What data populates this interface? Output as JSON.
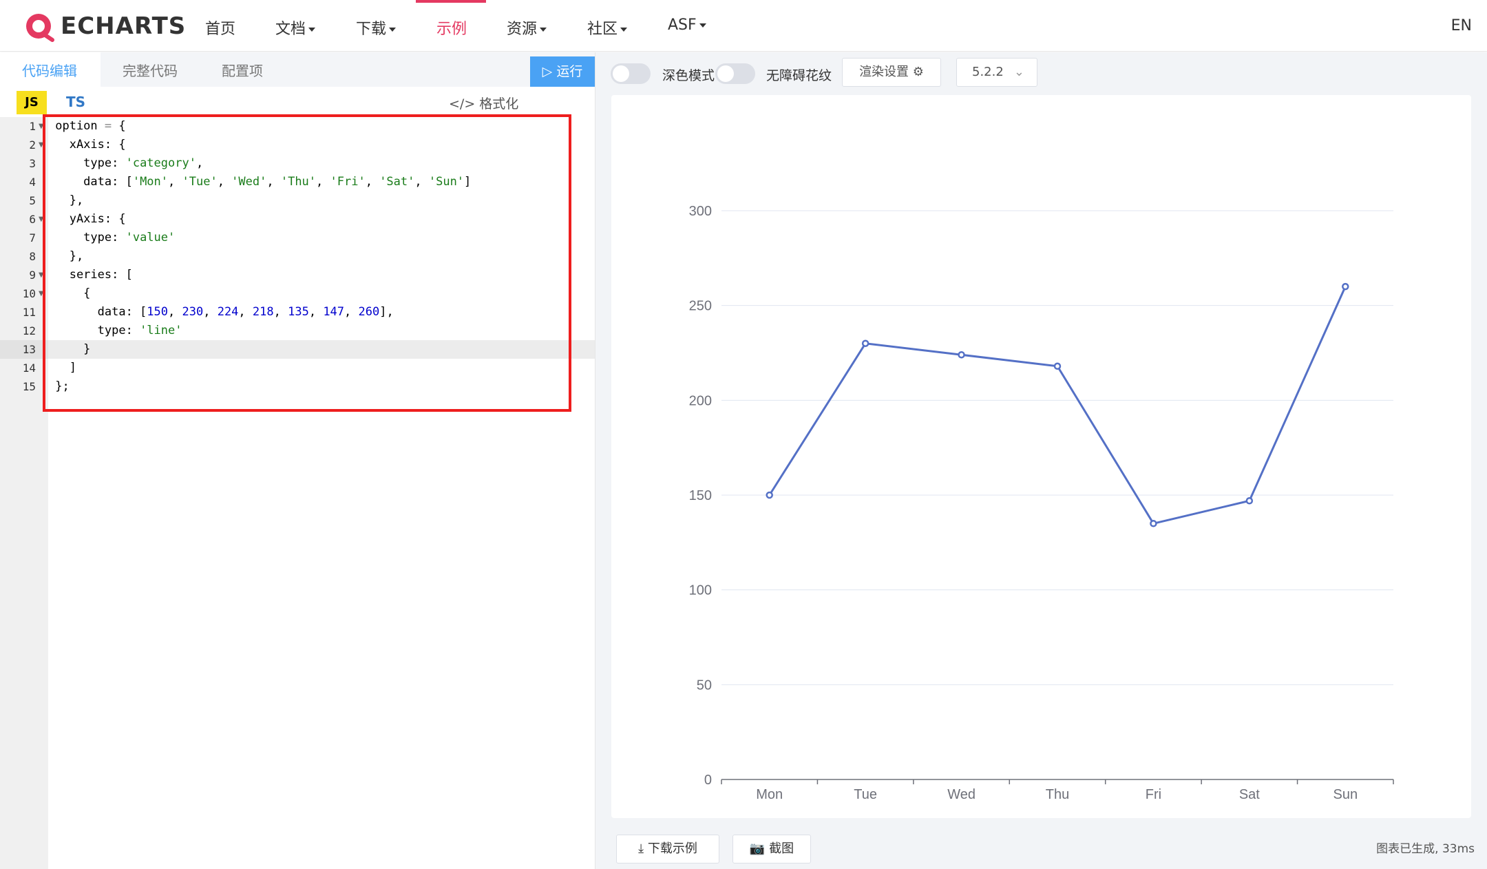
{
  "nav": {
    "logo": "ECHARTS",
    "items": [
      "首页",
      "文档",
      "下载",
      "示例",
      "资源",
      "社区",
      "ASF"
    ],
    "active": "示例",
    "lang": "EN"
  },
  "editor": {
    "tabs": [
      "代码编辑",
      "完整代码",
      "配置项"
    ],
    "js_label": "JS",
    "ts_label": "TS",
    "format_label": "格式化",
    "run_label": "运行",
    "line_numbers": [
      "1",
      "2",
      "3",
      "4",
      "5",
      "6",
      "7",
      "8",
      "9",
      "10",
      "11",
      "12",
      "13",
      "14",
      "15"
    ]
  },
  "preview": {
    "dark_mode_label": "深色模式",
    "accessibility_label": "无障碍花纹",
    "render_settings_label": "渲染设置",
    "version": "5.2.2",
    "download_label": "下载示例",
    "screenshot_label": "截图",
    "status": "图表已生成, 33ms"
  },
  "chart_data": {
    "type": "line",
    "categories": [
      "Mon",
      "Tue",
      "Wed",
      "Thu",
      "Fri",
      "Sat",
      "Sun"
    ],
    "series": [
      {
        "values": [
          150,
          230,
          224,
          218,
          135,
          147,
          260
        ]
      }
    ],
    "ylim": [
      0,
      300
    ],
    "yticks": [
      "0",
      "50",
      "100",
      "150",
      "200",
      "250",
      "300"
    ],
    "grid": true,
    "color": "#5470c6"
  },
  "colors": {
    "accent": "#e43961",
    "primary_blue": "#4aa2f4",
    "highlight_box": "#ee1e1e"
  }
}
